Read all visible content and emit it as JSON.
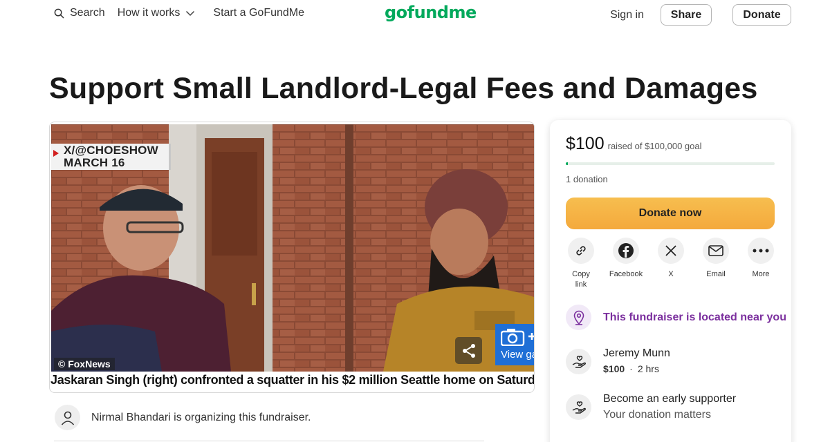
{
  "nav": {
    "search_label": "Search",
    "how_label": "How it works",
    "start_label": "Start a GoFundMe",
    "logo_text": "gofundme",
    "signin_label": "Sign in",
    "share_label": "Share",
    "donate_label": "Donate"
  },
  "campaign": {
    "title": "Support Small Landlord-Legal Fees and Damages",
    "image_watermark_line1": "X/@CHOESHOW",
    "image_watermark_line2": "MARCH 16",
    "image_credit": "© FoxNews",
    "image_caption": "Jaskaran Singh (right) confronted a squatter in his $2 million Seattle home on Saturday",
    "gallery_label": "View ga",
    "organizer_text": "Nirmal Bhandari is organizing this fundraiser."
  },
  "card": {
    "raised": "$100",
    "goal_text": "raised of $100,000 goal",
    "progress_fraction": 0.001,
    "donation_count": "1 donation",
    "donate_now_label": "Donate now",
    "share_options": [
      {
        "label": "Copy link",
        "icon": "link-icon"
      },
      {
        "label": "Facebook",
        "icon": "facebook-icon"
      },
      {
        "label": "X",
        "icon": "x-icon"
      },
      {
        "label": "Email",
        "icon": "email-icon"
      },
      {
        "label": "More",
        "icon": "more-icon"
      }
    ],
    "near_you_text": "This fundraiser is located near you",
    "recent_donor": {
      "name": "Jeremy Munn",
      "amount": "$100",
      "time": "2 hrs"
    },
    "early_supporter": {
      "title": "Become an early supporter",
      "subtitle": "Your donation matters"
    }
  },
  "colors": {
    "brand_green": "#02a95c",
    "donate_orange": "#f4a93c",
    "near_purple": "#7b2f9e",
    "gallery_blue": "#1f6fd6"
  }
}
